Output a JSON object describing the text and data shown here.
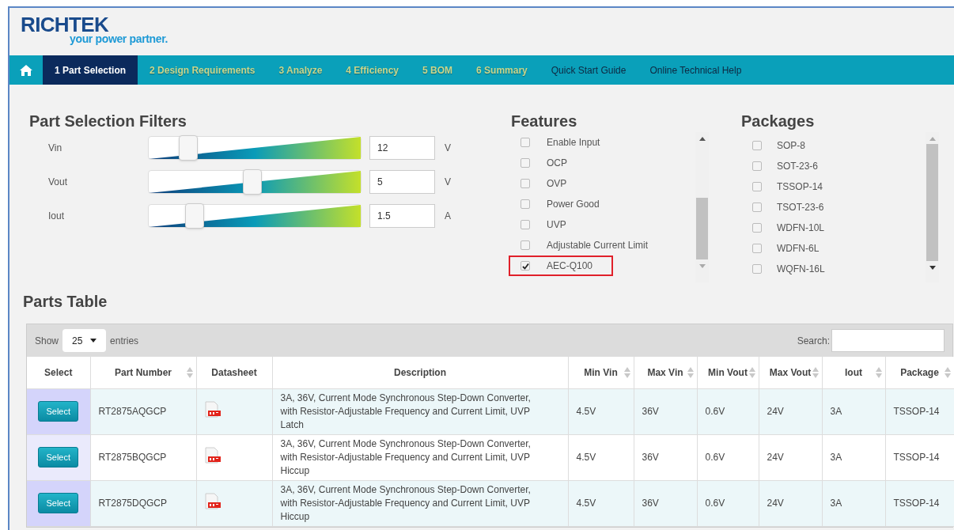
{
  "logo": {
    "name": "RICHTEK",
    "tagline": "your power partner."
  },
  "nav": [
    {
      "label": "1 Part Selection",
      "kind": "step",
      "selected": true
    },
    {
      "label": "2 Design Requirements",
      "kind": "step",
      "selected": false
    },
    {
      "label": "3 Analyze",
      "kind": "step",
      "selected": false
    },
    {
      "label": "4 Efficiency",
      "kind": "step",
      "selected": false
    },
    {
      "label": "5 BOM",
      "kind": "step",
      "selected": false
    },
    {
      "label": "6 Summary",
      "kind": "step",
      "selected": false
    },
    {
      "label": "Quick Start Guide",
      "kind": "link",
      "selected": false
    },
    {
      "label": "Online Technical Help",
      "kind": "link",
      "selected": false
    }
  ],
  "filters": {
    "title": "Part Selection Filters",
    "sliders": [
      {
        "label": "Vin",
        "level": 0.14,
        "value": "12",
        "unit": "V"
      },
      {
        "label": "Vout",
        "level": 0.44,
        "value": "5",
        "unit": "V"
      },
      {
        "label": "Iout",
        "level": 0.17,
        "value": "1.5",
        "unit": "A"
      }
    ]
  },
  "features": {
    "title": "Features",
    "items": [
      {
        "label": "Enable Input",
        "checked": false,
        "highlighted": false
      },
      {
        "label": "OCP",
        "checked": false,
        "highlighted": false
      },
      {
        "label": "OVP",
        "checked": false,
        "highlighted": false
      },
      {
        "label": "Power Good",
        "checked": false,
        "highlighted": false
      },
      {
        "label": "UVP",
        "checked": false,
        "highlighted": false
      },
      {
        "label": "Adjustable Current Limit",
        "checked": false,
        "highlighted": false
      },
      {
        "label": "AEC-Q100",
        "checked": true,
        "highlighted": true
      }
    ]
  },
  "packages": {
    "title": "Packages",
    "items": [
      {
        "label": "SOP-8",
        "checked": false
      },
      {
        "label": "SOT-23-6",
        "checked": false
      },
      {
        "label": "TSSOP-14",
        "checked": false
      },
      {
        "label": "TSOT-23-6",
        "checked": false
      },
      {
        "label": "WDFN-10L",
        "checked": false
      },
      {
        "label": "WDFN-6L",
        "checked": false
      },
      {
        "label": "WQFN-16L",
        "checked": false
      }
    ]
  },
  "parts_table": {
    "title": "Parts Table",
    "show_label": "Show",
    "page_size": "25",
    "entries_label": "entries",
    "search_label": "Search:",
    "columns": [
      {
        "label": "Select",
        "sortable": false
      },
      {
        "label": "Part Number",
        "sortable": true
      },
      {
        "label": "Datasheet",
        "sortable": false
      },
      {
        "label": "Description",
        "sortable": false
      },
      {
        "label": "Min Vin",
        "sortable": true
      },
      {
        "label": "Max Vin",
        "sortable": true
      },
      {
        "label": "Min Vout",
        "sortable": true
      },
      {
        "label": "Max Vout",
        "sortable": true
      },
      {
        "label": "Iout",
        "sortable": true
      },
      {
        "label": "Package",
        "sortable": true
      }
    ],
    "rows": [
      {
        "button": "Select",
        "part_number": "RT2875AQGCP",
        "description": "3A, 36V, Current Mode Synchronous Step-Down Converter, with Resistor-Adjustable Frequency and Current Limit, UVP Latch",
        "min_vin": "4.5V",
        "max_vin": "36V",
        "min_vout": "0.6V",
        "max_vout": "24V",
        "iout": "3A",
        "package": "TSSOP-14"
      },
      {
        "button": "Select",
        "part_number": "RT2875BQGCP",
        "description": "3A, 36V, Current Mode Synchronous Step-Down Converter, with Resistor-Adjustable Frequency and Current Limit, UVP Hiccup",
        "min_vin": "4.5V",
        "max_vin": "36V",
        "min_vout": "0.6V",
        "max_vout": "24V",
        "iout": "3A",
        "package": "TSSOP-14"
      },
      {
        "button": "Select",
        "part_number": "RT2875DQGCP",
        "description": "3A, 36V, Current Mode Synchronous Step-Down Converter, with Resistor-Adjustable Frequency and Current Limit, UVP Hiccup",
        "min_vin": "4.5V",
        "max_vin": "36V",
        "min_vout": "0.6V",
        "max_vout": "24V",
        "iout": "3A",
        "package": "TSSOP-14"
      }
    ]
  }
}
